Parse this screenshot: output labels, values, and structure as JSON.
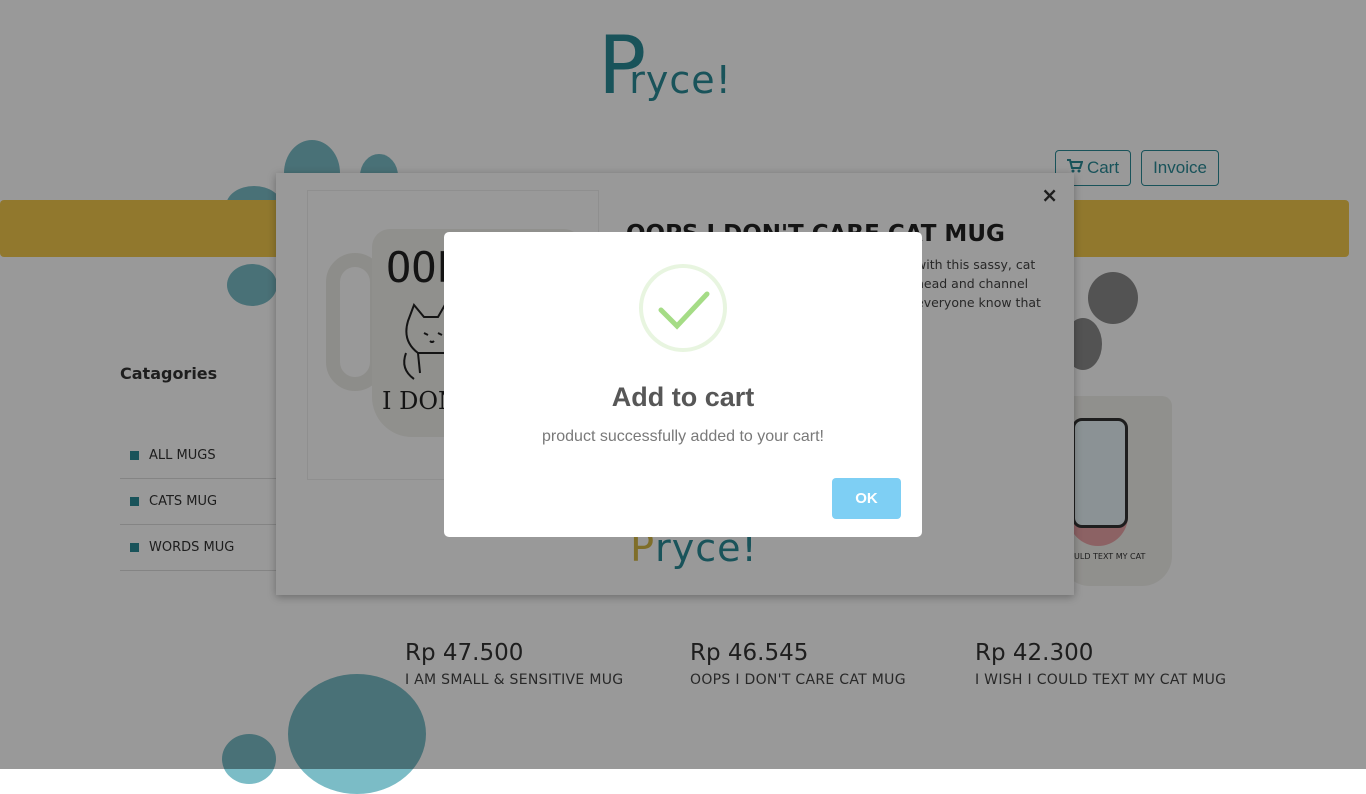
{
  "brand": {
    "logo_first": "P",
    "logo_rest": "ryce!",
    "accent": "#2a8a97",
    "secondary": "#f2c94c"
  },
  "header": {
    "cart_label": "Cart",
    "invoice_label": "Invoice",
    "cart_icon": "cart-icon"
  },
  "sidebar": {
    "title": "Catagories",
    "items": [
      {
        "label": "ALL MUGS"
      },
      {
        "label": "CATS MUG"
      },
      {
        "label": "WORDS MUG"
      }
    ]
  },
  "products": [
    {
      "price": "Rp 47.500",
      "name": "I AM SMALL & SENSITIVE MUG"
    },
    {
      "price": "Rp 46.545",
      "name": "OOPS I DON'T CARE CAT MUG"
    },
    {
      "price": "Rp 42.300",
      "name": "I WISH I COULD TEXT MY CAT MUG"
    }
  ],
  "product_modal": {
    "title": "OOPS I DON'T CARE CAT MUG",
    "description": "with this sassy, cat head and channel everyone know that",
    "mug_text_top": "OOP",
    "mug_text_bottom": "I DON'T",
    "right_mug_text": "ULD TEXT MY CAT",
    "close_label": "×"
  },
  "alert": {
    "icon": "success-check-icon",
    "title": "Add to cart",
    "text": "product successfully added to your cart!",
    "ok_label": "OK",
    "ok_color": "#7ecff4"
  }
}
